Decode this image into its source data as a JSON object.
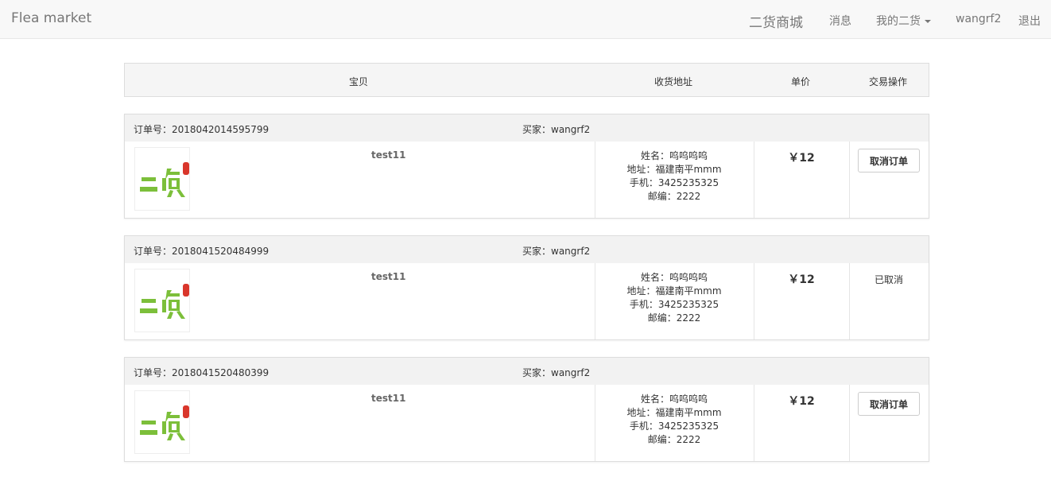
{
  "navbar": {
    "brand": "Flea market",
    "links": {
      "mall": "二货商城",
      "messages": "消息",
      "my_items": "我的二货",
      "username": "wangrf2",
      "logout": "退出"
    }
  },
  "table_header": {
    "item": "宝贝",
    "address": "收货地址",
    "unit_price": "单价",
    "action": "交易操作"
  },
  "labels": {
    "order_no": "订单号：",
    "buyer": "买家："
  },
  "logo_text": "二货",
  "orders": [
    {
      "order_no": "2018042014595799",
      "buyer": "wangrf2",
      "item_name": "test11",
      "address": {
        "name": "姓名：呜呜呜呜",
        "addr": "地址：福建南平mmm",
        "phone": "手机：3425235325",
        "zip": "邮编：2222"
      },
      "price": "￥12",
      "action_label": "取消订单"
    },
    {
      "order_no": "2018041520484999",
      "buyer": "wangrf2",
      "item_name": "test11",
      "address": {
        "name": "姓名：呜呜呜呜",
        "addr": "地址：福建南平mmm",
        "phone": "手机：3425235325",
        "zip": "邮编：2222"
      },
      "price": "￥12",
      "status": "已取消"
    },
    {
      "order_no": "2018041520480399",
      "buyer": "wangrf2",
      "item_name": "test11",
      "address": {
        "name": "姓名：呜呜呜呜",
        "addr": "地址：福建南平mmm",
        "phone": "手机：3425235325",
        "zip": "邮编：2222"
      },
      "price": "￥12",
      "action_label": "取消订单"
    }
  ],
  "colors": {
    "logo_green": "#7cbf3a",
    "logo_red": "#d9362b",
    "navbar_bg": "#f8f8f8"
  }
}
